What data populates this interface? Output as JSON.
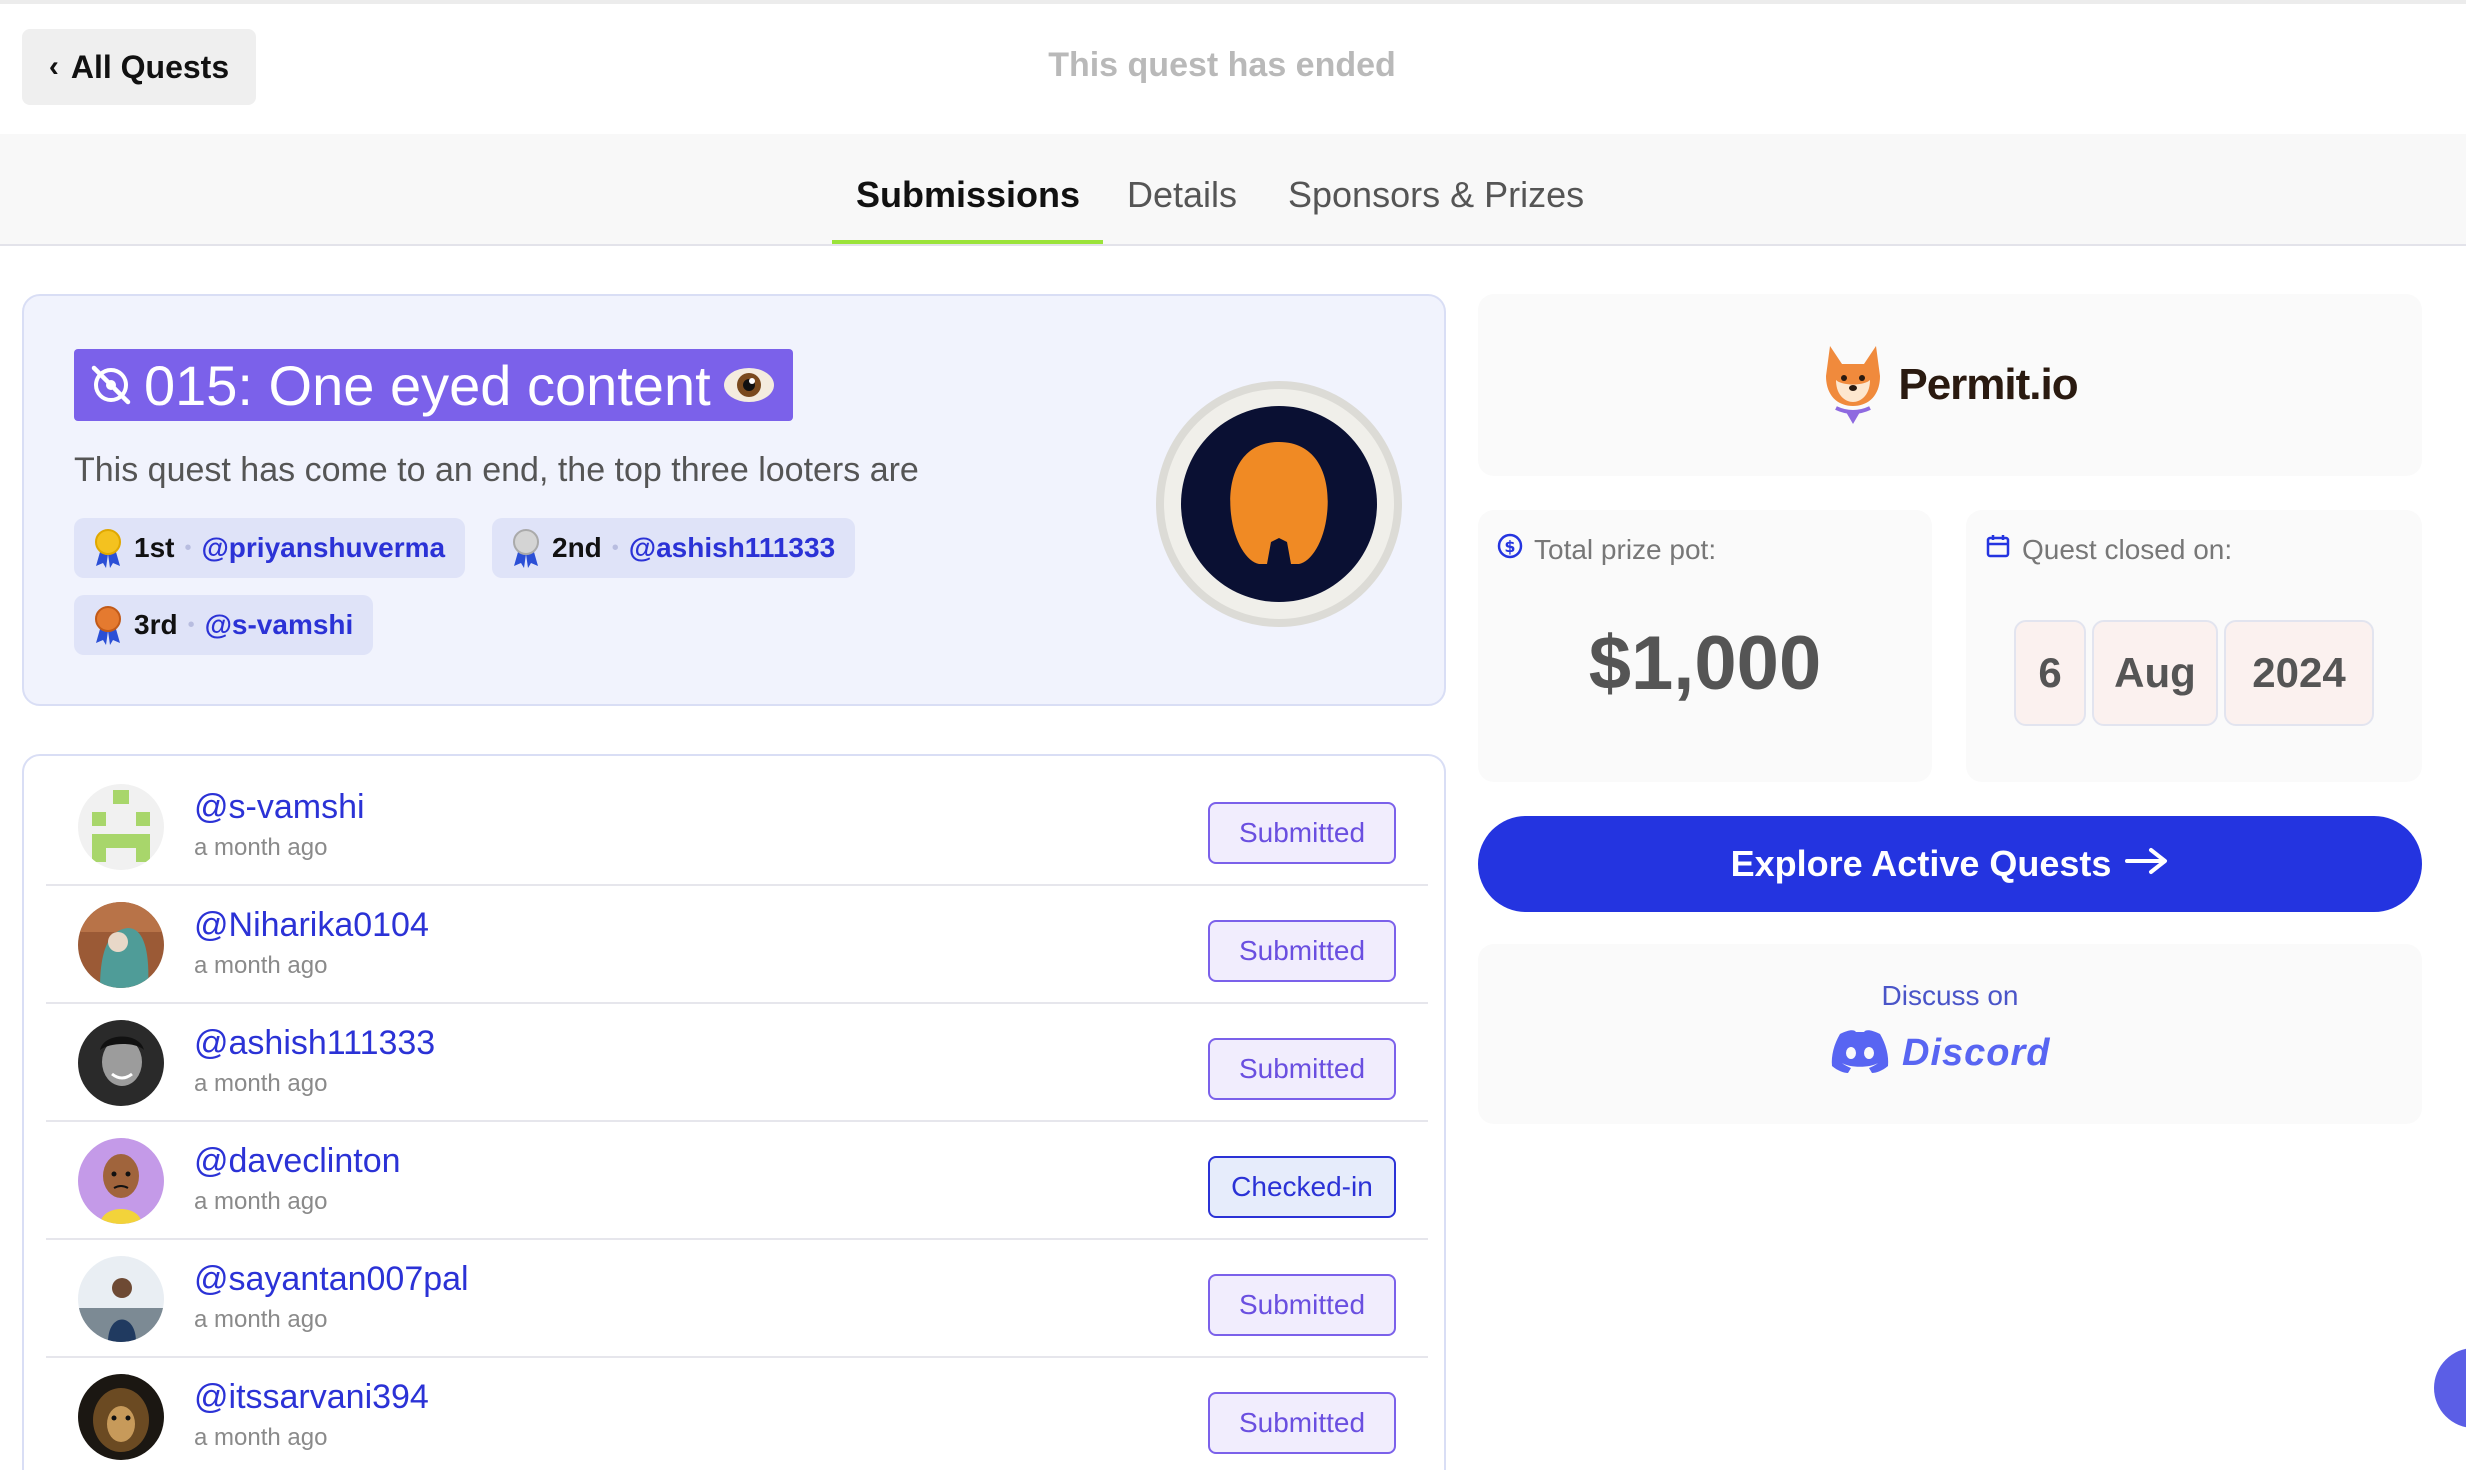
{
  "header": {
    "back_label": "All Quests",
    "status_text": "This quest has ended"
  },
  "tabs": [
    {
      "label": "Submissions",
      "active": true
    },
    {
      "label": "Details",
      "active": false
    },
    {
      "label": "Sponsors & Prizes",
      "active": false
    }
  ],
  "quest": {
    "title": "015: One eyed content",
    "subtitle": "This quest has come to an end, the top three looters are",
    "winners": [
      {
        "place": "1st",
        "handle": "@priyanshuverma",
        "medal_color": "#f4c21f"
      },
      {
        "place": "2nd",
        "handle": "@ashish111333",
        "medal_color": "#c9c9c9"
      },
      {
        "place": "3rd",
        "handle": "@s-vamshi",
        "medal_color": "#e57a2f"
      }
    ]
  },
  "submissions": [
    {
      "handle": "@s-vamshi",
      "time": "a month ago",
      "status": "Submitted"
    },
    {
      "handle": "@Niharika0104",
      "time": "a month ago",
      "status": "Submitted"
    },
    {
      "handle": "@ashish111333",
      "time": "a month ago",
      "status": "Submitted"
    },
    {
      "handle": "@daveclinton",
      "time": "a month ago",
      "status": "Checked-in"
    },
    {
      "handle": "@sayantan007pal",
      "time": "a month ago",
      "status": "Submitted"
    },
    {
      "handle": "@itssarvani394",
      "time": "a month ago",
      "status": "Submitted"
    }
  ],
  "sponsor": {
    "name": "Permit.io"
  },
  "prize": {
    "label": "Total prize pot:",
    "amount": "$1,000"
  },
  "closed": {
    "label": "Quest closed on:",
    "day": "6",
    "month": "Aug",
    "year": "2024"
  },
  "explore_label": "Explore Active Quests",
  "discord": {
    "discuss_label": "Discuss on",
    "name": "Discord"
  },
  "colors": {
    "accent": "#2434e0",
    "quest_title_bg": "#7b61ea",
    "tab_underline": "#9be33a",
    "link": "#2b32d6"
  }
}
